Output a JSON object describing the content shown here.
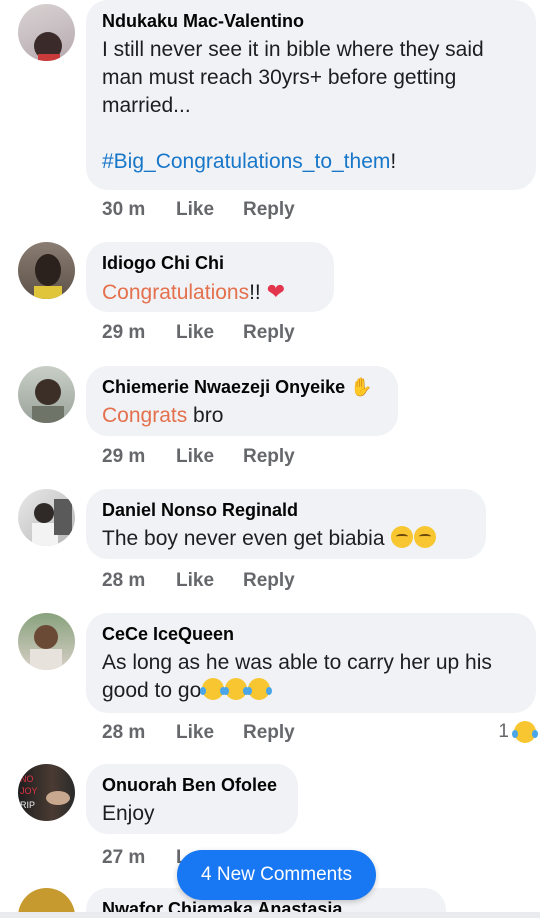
{
  "comments": [
    {
      "author": "Ndukaku Mac-Valentino",
      "text": "I still never see it in bible where they said man must reach 30yrs+ before getting married...",
      "link": "#Big_Congratulations_to_them",
      "link_suffix": "!",
      "time": "30 m",
      "like": "Like",
      "reply": "Reply"
    },
    {
      "author": "Idiogo Chi Chi",
      "highlight": "Congratulations",
      "text_suffix": "!!",
      "emoji": "sparkling-heart",
      "time": "29 m",
      "like": "Like",
      "reply": "Reply"
    },
    {
      "author": "Chiemerie Nwaezeji Onyeike",
      "badge": "waving-hand",
      "highlight": "Congrats",
      "text_suffix": " bro",
      "time": "29 m",
      "like": "Like",
      "reply": "Reply"
    },
    {
      "author": "Daniel Nonso Reginald",
      "text": "The boy never even get biabia",
      "emoji": "relieved-face x2",
      "time": "28 m",
      "like": "Like",
      "reply": "Reply"
    },
    {
      "author": "CeCe IceQueen",
      "text": "As long as he was able to carry her up his good to go",
      "emoji": "tears-of-joy x3",
      "time": "28 m",
      "like": "Like",
      "reply": "Reply",
      "reaction_count": "1",
      "reaction": "laughing-face"
    },
    {
      "author": "Onuorah Ben Ofolee",
      "text": "Enjoy",
      "time": "27 m",
      "like": "L"
    }
  ],
  "new_comments_button": "4 New Comments",
  "partial_author": "Nwafor Chiamaka Anastasia",
  "colors": {
    "link": "#1877c9",
    "highlight": "#e4704d",
    "button": "#1877f2",
    "bubble": "#f0f2f5"
  }
}
